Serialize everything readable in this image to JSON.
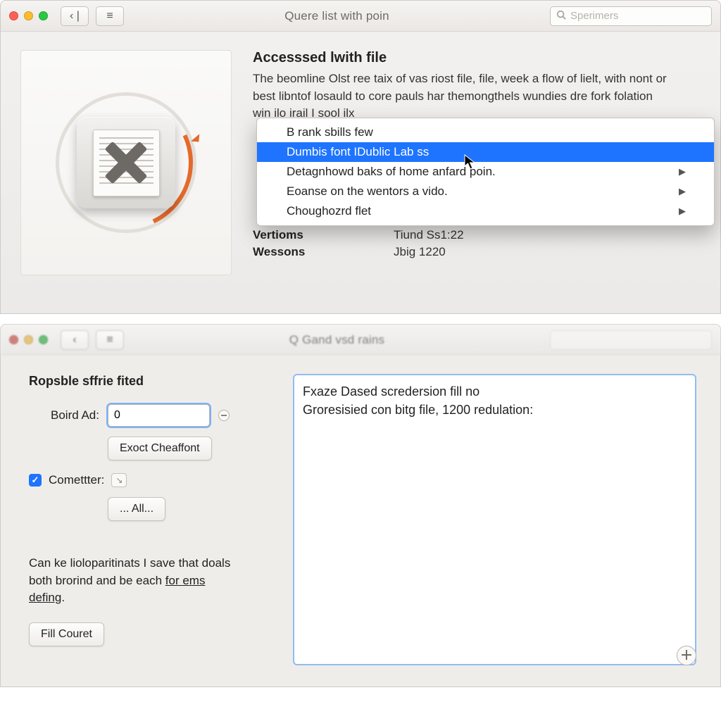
{
  "top": {
    "title": "Quere list with poin",
    "search_placeholder": "Sperimers",
    "info": {
      "heading": "Accesssed lwith file",
      "desc": "The beomline Olst ree taix of vas riost file, file, week a flow of lielt, with nont or best libntof losauld to core pauls har themongthels wundies dre fork folation win ilo irail   I sool ilx"
    },
    "menu": {
      "items": [
        {
          "label": "B rank sbills few",
          "submenu": false,
          "selected": false
        },
        {
          "label": "Dumbis font IDublic Lab ss",
          "submenu": false,
          "selected": true
        },
        {
          "label": "Detagnhowd baks of home anfard poin.",
          "submenu": true,
          "selected": false
        },
        {
          "label": "Eoanse on the wentors a vido.",
          "submenu": true,
          "selected": false
        },
        {
          "label": "Choughozrd flet",
          "submenu": true,
          "selected": false
        }
      ]
    },
    "meta": [
      {
        "key": "Vertioms",
        "val": "Tiund Ss1:22"
      },
      {
        "key": "Wessons",
        "val": "Jbig 1220"
      }
    ]
  },
  "bottom": {
    "title_blurred": "Q Gand vsd rains",
    "section_heading": "Ropsble sffrie fited",
    "form": {
      "boird_label": "Boird Ad:",
      "boird_value": "0",
      "exoct_btn": "Exoct Cheaffont",
      "cometter_label": "Comettter:",
      "all_btn": "... All..."
    },
    "hint_line1": "Can ke lioloparitinats I save that doals both brorind and be each ",
    "hint_link": "for ems defing",
    "hint_tail": ".",
    "fill_btn": "Fill Couret",
    "pane_lines": [
      "Fxaze Dased scredersion fill no",
      "Groresisied con bitg file, 1200 redulation:"
    ]
  }
}
